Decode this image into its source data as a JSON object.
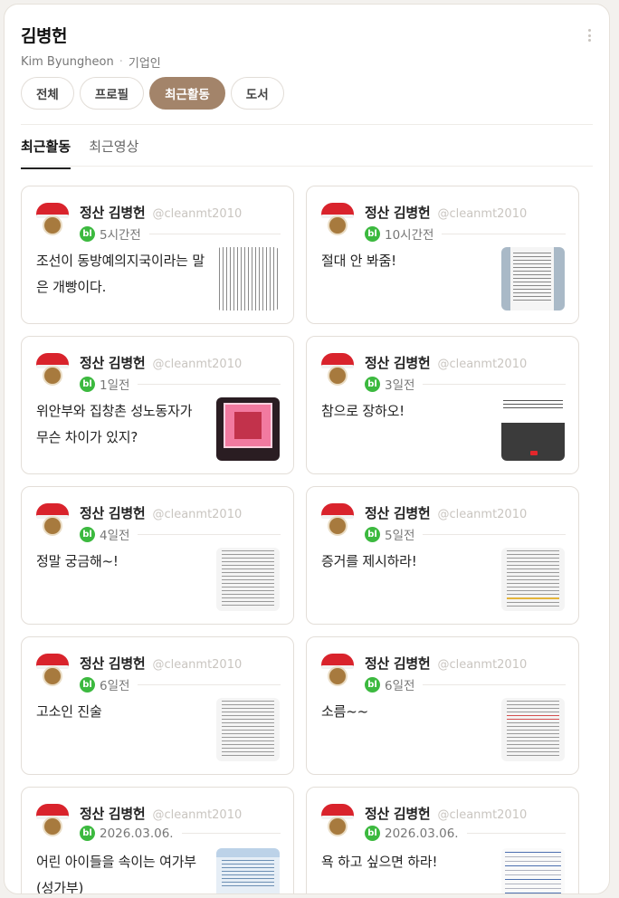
{
  "profile": {
    "name": "김병헌",
    "romanized": "Kim Byungheon",
    "dot": "·",
    "type": "기업인"
  },
  "tabs": [
    {
      "label": "전체",
      "active": false
    },
    {
      "label": "프로필",
      "active": false
    },
    {
      "label": "최근활동",
      "active": true
    },
    {
      "label": "도서",
      "active": false
    }
  ],
  "subtabs": [
    {
      "label": "최근활동",
      "active": true
    },
    {
      "label": "최근영상",
      "active": false
    }
  ],
  "badge_text": "bl",
  "colors": {
    "accent": "#a3846a",
    "badge": "#3cb93f"
  },
  "posts": [
    {
      "author": "정산 김병헌",
      "handle": "@cleanmt2010",
      "time": "5시간전",
      "text": "조선이 동방예의지국이라는 말은 개빵이다.",
      "thumb": "newspaper-scan"
    },
    {
      "author": "정산 김병헌",
      "handle": "@cleanmt2010",
      "time": "10시간전",
      "text": "절대 안 봐줌!",
      "thumb": "document-page"
    },
    {
      "author": "정산 김병헌",
      "handle": "@cleanmt2010",
      "time": "1일전",
      "text": "위안부와 집창촌 성노동자가 무슨 차이가 있지?",
      "thumb": "red-window-photo"
    },
    {
      "author": "정산 김병헌",
      "handle": "@cleanmt2010",
      "time": "3일전",
      "text": "참으로 장하오!",
      "thumb": "video-screenshot"
    },
    {
      "author": "정산 김병헌",
      "handle": "@cleanmt2010",
      "time": "4일전",
      "text": "정말 궁금해~!",
      "thumb": "text-document"
    },
    {
      "author": "정산 김병헌",
      "handle": "@cleanmt2010",
      "time": "5일전",
      "text": "증거를 제시하라!",
      "thumb": "highlighted-document"
    },
    {
      "author": "정산 김병헌",
      "handle": "@cleanmt2010",
      "time": "6일전",
      "text": "고소인 진술",
      "thumb": "text-document"
    },
    {
      "author": "정산 김병헌",
      "handle": "@cleanmt2010",
      "time": "6일전",
      "text": "소름~~",
      "thumb": "text-document-red"
    },
    {
      "author": "정산 김병헌",
      "handle": "@cleanmt2010",
      "time": "2026.03.06.",
      "text": "어린 아이들을 속이는 여가부(성가부)",
      "thumb": "blue-leaflet"
    },
    {
      "author": "정산 김병헌",
      "handle": "@cleanmt2010",
      "time": "2026.03.06.",
      "text": "욕 하고 싶으면 하라!",
      "thumb": "data-table"
    }
  ]
}
